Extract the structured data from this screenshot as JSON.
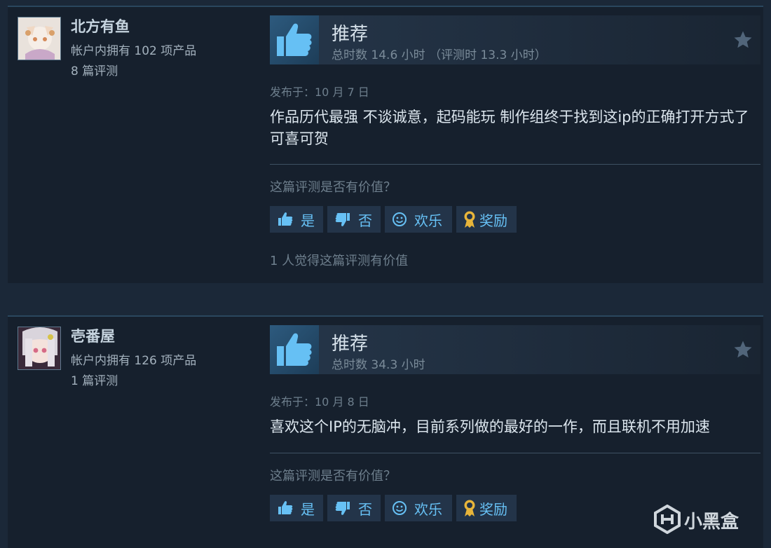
{
  "reviews": [
    {
      "author": "北方有鱼",
      "owned": "帐户内拥有 102 项产品",
      "review_count": "8 篇评测",
      "verdict": "推荐",
      "hours": "总时数 14.6 小时 （评测时 13.3 小时）",
      "posted": "发布于：10 月 7 日",
      "content": "作品历代最强 不谈诚意，起码能玩 制作组终于找到这ip的正确打开方式了 可喜可贺",
      "helpful_question": "这篇评测是否有价值？",
      "buttons": {
        "yes": "是",
        "no": "否",
        "funny": "欢乐",
        "award": "奖励"
      },
      "found_helpful": "1 人觉得这篇评测有价值"
    },
    {
      "author": "壱番屋",
      "owned": "帐户内拥有 126 项产品",
      "review_count": "1 篇评测",
      "verdict": "推荐",
      "hours": "总时数 34.3 小时",
      "posted": "发布于：10 月 8 日",
      "content": "喜欢这个IP的无脑冲，目前系列做的最好的一作，而且联机不用加速",
      "helpful_question": "这篇评测是否有价值？",
      "buttons": {
        "yes": "是",
        "no": "否",
        "funny": "欢乐",
        "award": "奖励"
      }
    }
  ],
  "watermark": {
    "text": "小黑盒"
  },
  "icons": {
    "verdict": "thumbs-up-icon",
    "favorite": "star-icon",
    "yes": "thumbs-up-icon",
    "no": "thumbs-down-icon",
    "funny": "smiley-icon",
    "award": "award-ribbon-icon",
    "watermark": "heybox-logo-icon"
  },
  "colors": {
    "page_bg": "#1b2838",
    "card_bg": "#16202d",
    "link_blue": "#67c1f5",
    "thumb_blue": "#66c0f4",
    "award_gold": "#e8b53a"
  }
}
